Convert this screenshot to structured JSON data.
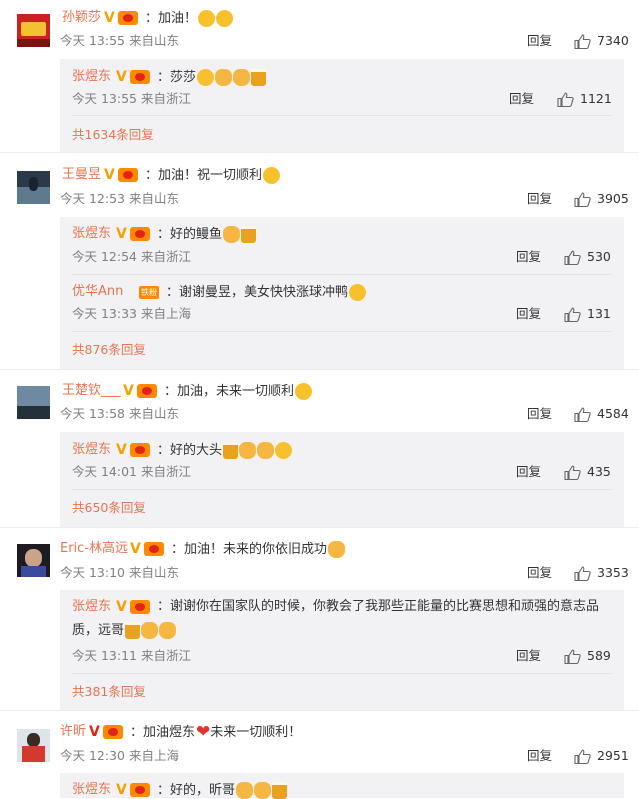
{
  "reply_label": "回复",
  "comments": [
    {
      "id": "c1",
      "name": "孙颖莎",
      "verified": "V",
      "text": "：加油！",
      "emojis": [
        "smile",
        "smile"
      ],
      "time": "今天 13:55 来自山东",
      "likes": "7340",
      "replies": [
        {
          "name": "张煜东",
          "verified": "V",
          "text": "：莎莎",
          "emojis": [
            "grin",
            "hand",
            "hand",
            "beer"
          ],
          "time": "今天 13:55 来自浙江",
          "likes": "1121"
        }
      ],
      "more": "共1634条回复"
    },
    {
      "id": "c2",
      "name": "王曼昱",
      "verified": "V",
      "text": "：加油！祝一切顺利",
      "emojis": [
        "smile"
      ],
      "time": "今天 12:53 来自山东",
      "likes": "3905",
      "replies": [
        {
          "name": "张煜东",
          "verified": "V",
          "text": "：好的鳗鱼",
          "emojis": [
            "hand",
            "beer"
          ],
          "time": "今天 12:54 来自浙江",
          "likes": "530"
        },
        {
          "name": "优华Ann",
          "tag": "铁粉",
          "text": "：谢谢曼昱，美女快快涨球冲鸭",
          "emojis": [
            "cry"
          ],
          "time": "今天 13:33 来自上海",
          "likes": "131"
        }
      ],
      "more": "共876条回复"
    },
    {
      "id": "c3",
      "name": "王楚钦___",
      "verified": "V",
      "text": "：加油，未来一切顺利",
      "emojis": [
        "cheer"
      ],
      "time": "今天 13:58 来自山东",
      "likes": "4584",
      "replies": [
        {
          "name": "张煜东",
          "verified": "V",
          "text": "：好的大头",
          "emojis": [
            "beer",
            "hand",
            "hand",
            "grin"
          ],
          "time": "今天 14:01 来自浙江",
          "likes": "435"
        }
      ],
      "more": "共650条回复"
    },
    {
      "id": "c4",
      "name": "Eric-林高远",
      "verified": "V",
      "text": "：加油！未来的你依旧成功",
      "emojis": [
        "hand"
      ],
      "time": "今天 13:10 来自山东",
      "likes": "3353",
      "replies": [
        {
          "name": "张煜东",
          "verified": "V",
          "text": "：谢谢你在国家队的时候，你教会了我那些正能量的比赛思想和顽强的意志品质，远哥",
          "emojis": [
            "beer",
            "hand",
            "hand"
          ],
          "time": "今天 13:11 来自浙江",
          "likes": "589"
        }
      ],
      "more": "共381条回复"
    },
    {
      "id": "c5",
      "name": "许昕",
      "verified": "V",
      "verified_color": "#e2231a",
      "text": "：加油煜东",
      "emojis": [
        "heart"
      ],
      "text2": "未来一切顺利！",
      "time": "今天 12:30 来自上海",
      "likes": "2951",
      "replies": [
        {
          "name": "张煜东",
          "verified": "V",
          "text": "：好的，昕哥",
          "emojis": [
            "hand",
            "hand",
            "beer"
          ]
        }
      ]
    }
  ],
  "colors": {
    "name": "#eb7350",
    "verified": "#f5a000",
    "text": "#333333",
    "time": "#808080",
    "reply_box": "#f2f2f5"
  }
}
